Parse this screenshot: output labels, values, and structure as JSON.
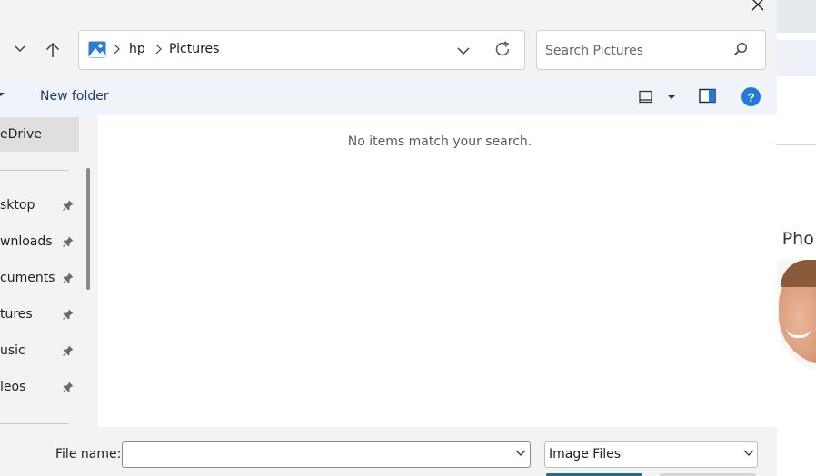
{
  "background_app": {
    "heading_fragment": "e Pho"
  },
  "address_bar": {
    "crumbs": [
      "hp",
      "Pictures"
    ]
  },
  "search": {
    "placeholder": "Search Pictures",
    "value": ""
  },
  "toolbar": {
    "new_folder_label": "New folder",
    "help_label": "?"
  },
  "nav_pane": {
    "onedrive_label": "eDrive",
    "items": [
      {
        "label": "sktop",
        "pinned": true,
        "icon": "pin-icon"
      },
      {
        "label": "wnloads",
        "pinned": true,
        "icon": "pin-icon"
      },
      {
        "label": "cuments",
        "pinned": true,
        "icon": "pin-icon"
      },
      {
        "label": "tures",
        "pinned": true,
        "icon": "pin-icon"
      },
      {
        "label": "usic",
        "pinned": true,
        "icon": "pin-icon"
      },
      {
        "label": "leos",
        "pinned": true,
        "icon": "pin-icon"
      }
    ]
  },
  "content": {
    "empty_message": "No items match your search."
  },
  "bottom": {
    "file_name_label": "File name:",
    "file_name_value": "",
    "file_type_selected": "Image Files"
  },
  "colors": {
    "accent": "#1f7ae0",
    "toolbar_bg": "#f0f3f9",
    "selected_nav": "#dfdfdf",
    "primary_button": "#1f6f8b"
  }
}
